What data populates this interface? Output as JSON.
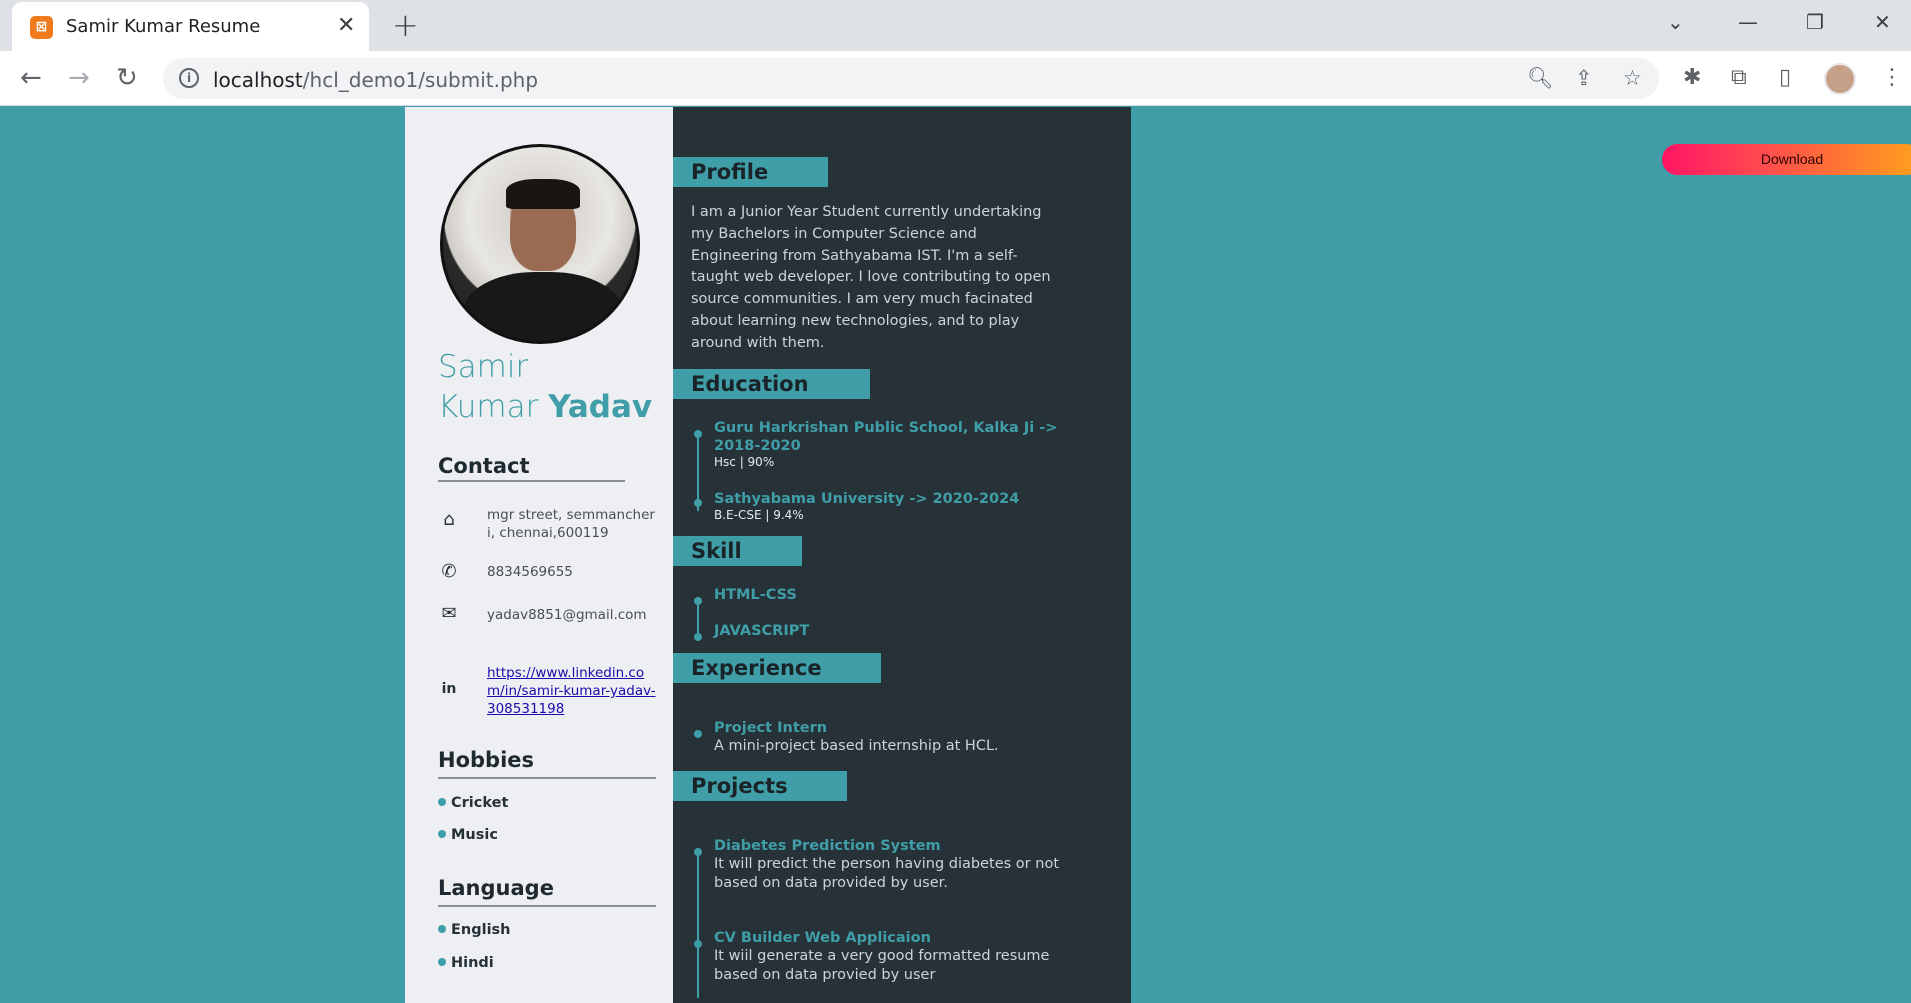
{
  "browser": {
    "tab_title": "Samir Kumar Resume",
    "tab_close": "✕",
    "new_tab": "+",
    "url_host": "localhost",
    "url_path": "/hcl_demo1/submit.php"
  },
  "page": {
    "download_label": "Download",
    "name_first": "Samir",
    "name_middle": "Kumar",
    "name_last": "Yadav",
    "contact": {
      "heading": "Contact",
      "address": "mgr street, semmancheri, chennai,600119",
      "phone": "8834569655",
      "email": "yadav8851@gmail.com",
      "linkedin": "https://www.linkedin.com/in/samir-kumar-yadav-308531198"
    },
    "hobbies": {
      "heading": "Hobbies",
      "items": [
        "Cricket",
        "Music"
      ]
    },
    "language": {
      "heading": "Language",
      "items": [
        "English",
        "Hindi"
      ]
    },
    "profile": {
      "heading": "Profile",
      "text": "I am a Junior Year Student currently undertaking my Bachelors in Computer Science and Engineering from Sathyabama IST. I'm a self-taught web developer. I love contributing to open source communities. I am very much facinated about learning new technologies, and to play around with them."
    },
    "education": {
      "heading": "Education",
      "items": [
        {
          "title": "Guru Harkrishan Public School, Kalka Ji -> 2018-2020",
          "sub": "Hsc | 90%"
        },
        {
          "title": "Sathyabama University -> 2020-2024",
          "sub": "B.E-CSE | 9.4%"
        }
      ]
    },
    "skill": {
      "heading": "Skill",
      "items": [
        "HTML-CSS",
        "JAVASCRIPT"
      ]
    },
    "experience": {
      "heading": "Experience",
      "items": [
        {
          "title": "Project Intern",
          "desc": "A mini-project based internship at HCL."
        }
      ]
    },
    "projects": {
      "heading": "Projects",
      "items": [
        {
          "title": "Diabetes Prediction System",
          "desc": "It will predict the person having diabetes or not based on data provided by user."
        },
        {
          "title": "CV Builder Web Applicaion",
          "desc": "It wiil generate a very good formatted resume based on data provied by user"
        }
      ]
    }
  }
}
